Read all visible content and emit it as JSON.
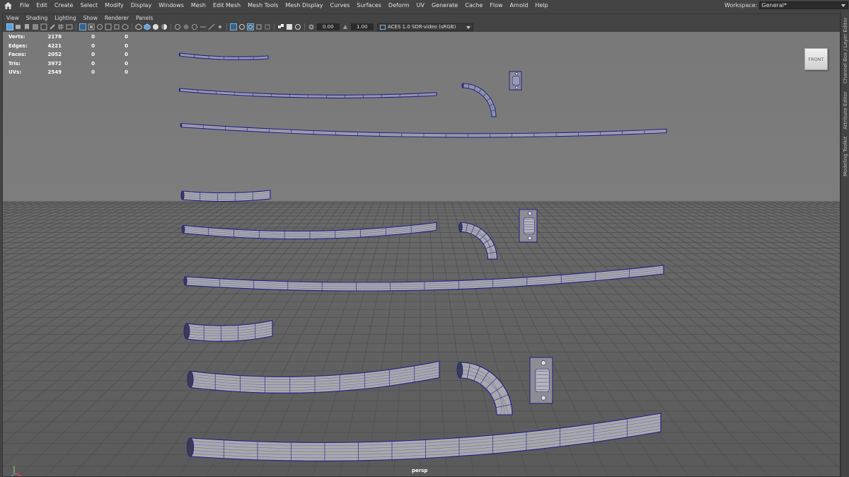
{
  "menubar": {
    "items": [
      "File",
      "Edit",
      "Create",
      "Select",
      "Modify",
      "Display",
      "Windows",
      "Mesh",
      "Edit Mesh",
      "Mesh Tools",
      "Mesh Display",
      "Curves",
      "Surfaces",
      "Deform",
      "UV",
      "Generate",
      "Cache",
      "Flow",
      "Arnold",
      "Help"
    ],
    "workspace_label": "Workspace:",
    "workspace_value": "General*"
  },
  "panel_menu": {
    "items": [
      "View",
      "Shading",
      "Lighting",
      "Show",
      "Renderer",
      "Panels"
    ]
  },
  "panel_toolbar": {
    "exposure": "0.00",
    "gamma": "1.00",
    "color_space": "ACES 1.0 SDR-video (sRGB)"
  },
  "hud": {
    "rows": [
      {
        "label": "Verts:",
        "v1": "2178",
        "v2": "0",
        "v3": "0"
      },
      {
        "label": "Edges:",
        "v1": "4221",
        "v2": "0",
        "v3": "0"
      },
      {
        "label": "Faces:",
        "v1": "2052",
        "v2": "0",
        "v3": "0"
      },
      {
        "label": "Tris:",
        "v1": "3972",
        "v2": "0",
        "v3": "0"
      },
      {
        "label": "UVs:",
        "v1": "2549",
        "v2": "0",
        "v3": "0"
      }
    ]
  },
  "view_cube": {
    "label": "FRONT"
  },
  "camera": {
    "label": "persp"
  },
  "right_tabs": [
    "Channel Box / Layer Editor",
    "Attribute Editor",
    "Modeling Toolkit"
  ],
  "colors": {
    "bg_top": "#7a7a7a",
    "bg_bottom": "#5d5d5d",
    "grid": "#4f4f4f",
    "wire": "#1c1e8c",
    "mesh": "#a9a9ad",
    "accent": "#5aa0dc"
  }
}
